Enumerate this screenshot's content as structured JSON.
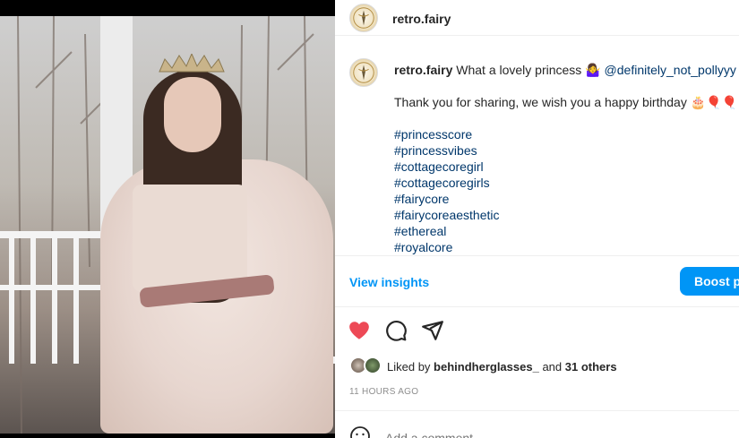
{
  "post": {
    "account": {
      "username": "retro.fairy"
    },
    "caption": {
      "username": "retro.fairy",
      "text_before_mention": "What a lovely princess 🤷‍♀️",
      "mention": "@definitely_not_pollyyy",
      "thanks_line": "Thank you for sharing, we wish you a happy birthday 🎂🎈🎈",
      "hashtags": [
        "#princesscore",
        "#princessvibes",
        "#cottagecoregirl",
        "#cottagecoregirls",
        "#fairycore",
        "#fairycoreaesthetic",
        "#ethereal",
        "#royalcore"
      ]
    },
    "insights": {
      "view_label": "View insights",
      "boost_label": "Boost post"
    },
    "actions": {
      "like_icon": "heart-filled-icon",
      "comment_icon": "comment-icon",
      "share_icon": "share-icon",
      "like_color": "#ed4956"
    },
    "likes": {
      "prefix": "Liked by ",
      "liker": "behindherglasses_",
      "middle": " and ",
      "others": "31 others"
    },
    "timestamp": "11 HOURS AGO",
    "comment": {
      "placeholder": "Add a comment...",
      "emoji_icon": "smiley-icon"
    }
  }
}
